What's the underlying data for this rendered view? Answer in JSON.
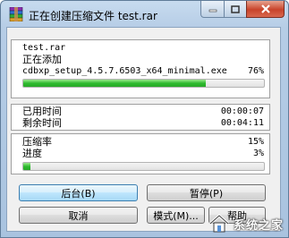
{
  "window": {
    "title": "正在创建压缩文件 test.rar"
  },
  "archive": {
    "name": "test.rar",
    "action": "正在添加",
    "current_file": "cdbxp_setup_4.5.7.6503_x64_minimal.exe",
    "file_percent": "76%",
    "file_progress": 0.76
  },
  "time": {
    "elapsed_label": "已用时间",
    "elapsed_value": "00:00:07",
    "remaining_label": "剩余时间",
    "remaining_value": "00:04:11"
  },
  "stats": {
    "ratio_label": "压缩率",
    "ratio_value": "15%",
    "progress_label": "进度",
    "progress_value": "3%",
    "total_progress": 0.03
  },
  "buttons": {
    "background": "后台(B)",
    "pause": "暂停(P)",
    "cancel": "取消",
    "mode": "模式(M)...",
    "help": "帮助"
  },
  "watermark": {
    "text": "系统之家"
  },
  "colors": {
    "progress_green": "#2fbb2f",
    "title_bg": "#b6cde6",
    "close_red": "#c8432a"
  }
}
